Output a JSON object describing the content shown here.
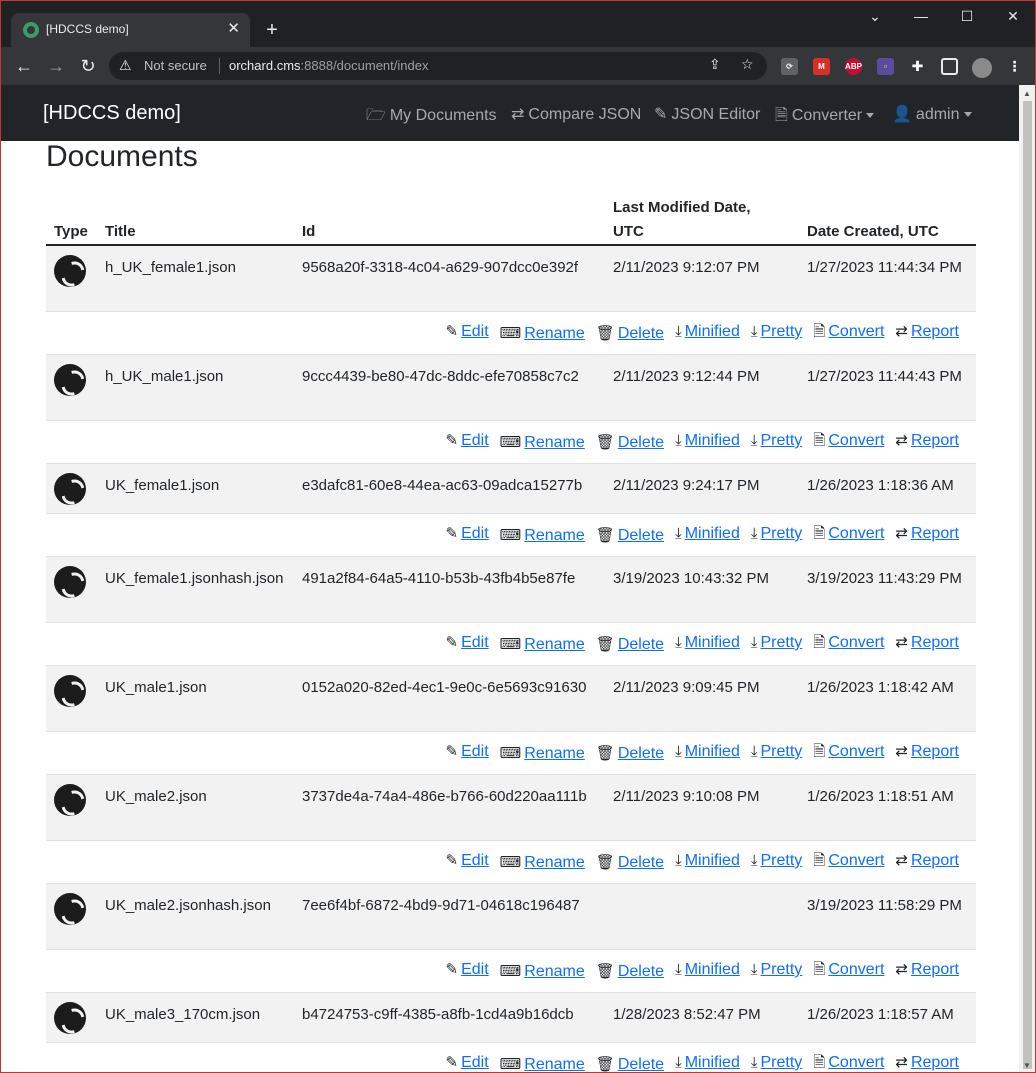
{
  "browser": {
    "tab_title": "[HDCCS demo]",
    "security_label": "Not secure",
    "url_host": "orchard.cms",
    "url_rest": ":8888/document/index"
  },
  "site": {
    "brand": "[HDCCS demo]",
    "nav": {
      "my_documents": "My Documents",
      "compare_json": "Compare JSON",
      "json_editor": "JSON Editor",
      "converter": "Converter",
      "admin": "admin"
    }
  },
  "page": {
    "title": "Documents"
  },
  "table": {
    "headers": {
      "type": "Type",
      "title": "Title",
      "id": "Id",
      "modified_line1": "Last Modified Date,",
      "modified_line2": "UTC",
      "created": "Date Created, UTC"
    },
    "actions": {
      "edit": "Edit",
      "rename": "Rename",
      "delete": "Delete",
      "minified": "Minified",
      "pretty": "Pretty",
      "convert": "Convert",
      "report": "Report"
    },
    "rows": [
      {
        "title": "h_UK_female1.json",
        "id": "9568a20f-3318-4c04-a629-907dcc0e392f",
        "modified": "2/11/2023 9:12:07 PM",
        "created": "1/27/2023 11:44:34 PM"
      },
      {
        "title": "h_UK_male1.json",
        "id": "9ccc4439-be80-47dc-8ddc-efe70858c7c2",
        "modified": "2/11/2023 9:12:44 PM",
        "created": "1/27/2023 11:44:43 PM"
      },
      {
        "title": "UK_female1.json",
        "id": "e3dafc81-60e8-44ea-ac63-09adca15277b",
        "modified": "2/11/2023 9:24:17 PM",
        "created": "1/26/2023 1:18:36 AM"
      },
      {
        "title": "UK_female1.jsonhash.json",
        "id": "491a2f84-64a5-4110-b53b-43fb4b5e87fe",
        "modified": "3/19/2023 10:43:32 PM",
        "created": "3/19/2023 11:43:29 PM"
      },
      {
        "title": "UK_male1.json",
        "id": "0152a020-82ed-4ec1-9e0c-6e5693c91630",
        "modified": "2/11/2023 9:09:45 PM",
        "created": "1/26/2023 1:18:42 AM"
      },
      {
        "title": "UK_male2.json",
        "id": "3737de4a-74a4-486e-b766-60d220aa111b",
        "modified": "2/11/2023 9:10:08 PM",
        "created": "1/26/2023 1:18:51 AM"
      },
      {
        "title": "UK_male2.jsonhash.json",
        "id": "7ee6f4bf-6872-4bd9-9d71-04618c196487",
        "modified": "",
        "created": "3/19/2023 11:58:29 PM"
      },
      {
        "title": "UK_male3_170cm.json",
        "id": "b4724753-c9ff-4385-a8fb-1cd4a9b16dcb",
        "modified": "1/28/2023 8:52:47 PM",
        "created": "1/26/2023 1:18:57 AM"
      }
    ]
  }
}
